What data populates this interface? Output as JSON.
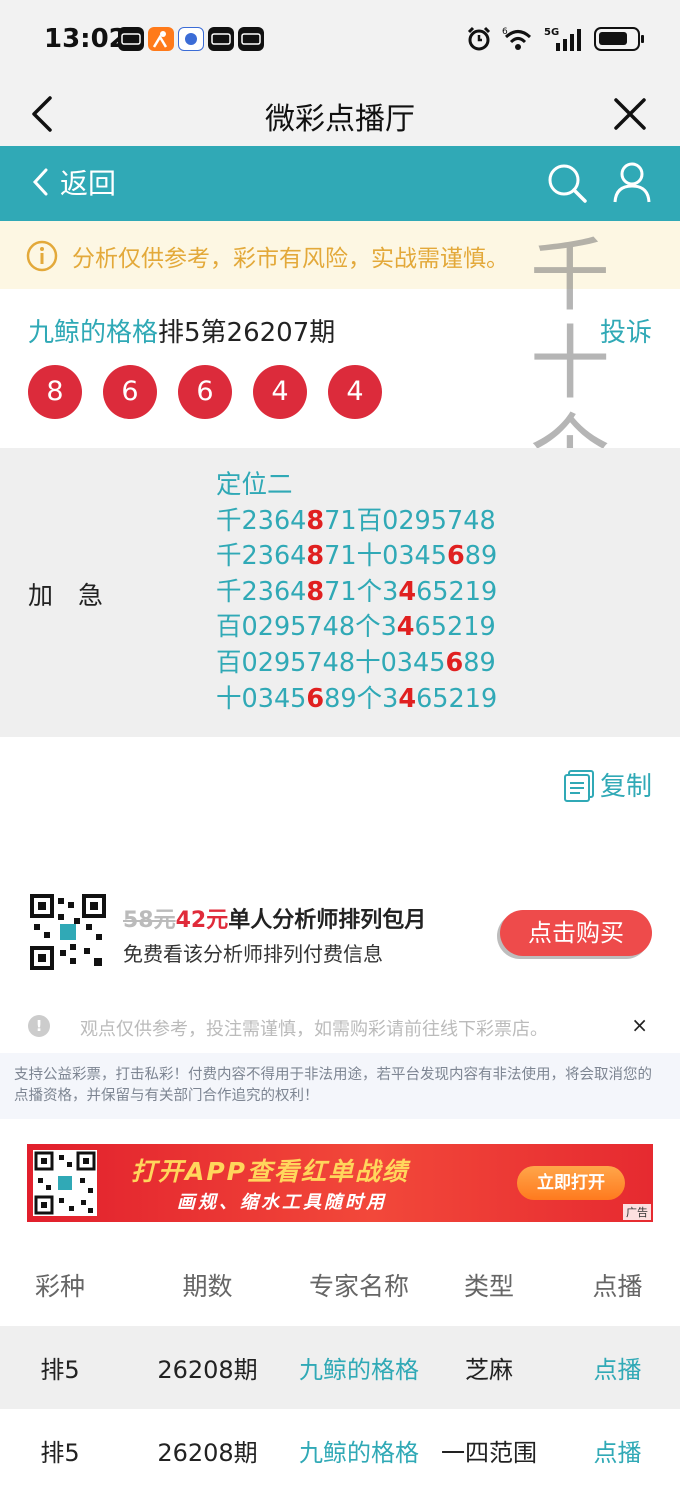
{
  "status": {
    "time": "13:02",
    "network": "5G",
    "wifi_badge": "6"
  },
  "nav": {
    "title": "微彩点播厅"
  },
  "toolbar": {
    "back_label": "返回"
  },
  "notice": {
    "text": "分析仅供参考，彩市有风险，实战需谨慎。"
  },
  "watermark": {
    "chars": [
      "千",
      "十",
      "个"
    ]
  },
  "issue": {
    "analyst": "九鲸的格格",
    "title": "排5第26207期",
    "complain_label": "投诉"
  },
  "balls": [
    "8",
    "6",
    "6",
    "4",
    "4"
  ],
  "content": {
    "label": "加　急",
    "heading": "定位二",
    "lines": [
      [
        {
          "t": "千2364"
        },
        {
          "t": "8",
          "hl": true
        },
        {
          "t": "71百0295748"
        }
      ],
      [
        {
          "t": "千2364"
        },
        {
          "t": "8",
          "hl": true
        },
        {
          "t": "71十0345"
        },
        {
          "t": "6",
          "hl": true
        },
        {
          "t": "89"
        }
      ],
      [
        {
          "t": "千2364"
        },
        {
          "t": "8",
          "hl": true
        },
        {
          "t": "71个3"
        },
        {
          "t": "4",
          "hl": true
        },
        {
          "t": "65219"
        }
      ],
      [
        {
          "t": "百0295748个3"
        },
        {
          "t": "4",
          "hl": true
        },
        {
          "t": "65219"
        }
      ],
      [
        {
          "t": "百0295748十0345"
        },
        {
          "t": "6",
          "hl": true
        },
        {
          "t": "89"
        }
      ],
      [
        {
          "t": "十0345"
        },
        {
          "t": "6",
          "hl": true
        },
        {
          "t": "89个3"
        },
        {
          "t": "4",
          "hl": true
        },
        {
          "t": "65219"
        }
      ]
    ]
  },
  "copy": {
    "label": "复制"
  },
  "promo": {
    "old_price": "58元",
    "new_price": "42元",
    "title": "单人分析师排列包月",
    "subtitle": "免费看该分析师排列付费信息",
    "buy_label": "点击购买"
  },
  "tip": {
    "text": "观点仅供参考，投注需谨慎，如需购彩请前往线下彩票店。",
    "close": "×"
  },
  "legal": {
    "text": "支持公益彩票，打击私彩！付费内容不得用于非法用途，若平台发现内容有非法使用，将会取消您的点播资格，并保留与有关部门合作追究的权利！"
  },
  "banner": {
    "title": "打开APP查看红单战绩",
    "subtitle": "画规、缩水工具随时用",
    "button": "立即打开",
    "ad": "广告"
  },
  "table": {
    "headers": [
      "彩种",
      "期数",
      "专家名称",
      "类型",
      "点播"
    ],
    "rows": [
      [
        "排5",
        "26208期",
        "九鲸的格格",
        "芝麻",
        "点播"
      ],
      [
        "排5",
        "26208期",
        "九鲸的格格",
        "一四范围",
        "点播"
      ]
    ]
  },
  "colors": {
    "teal": "#30a9b6",
    "red": "#dc2b3b",
    "notice_text": "#e3a93a"
  }
}
